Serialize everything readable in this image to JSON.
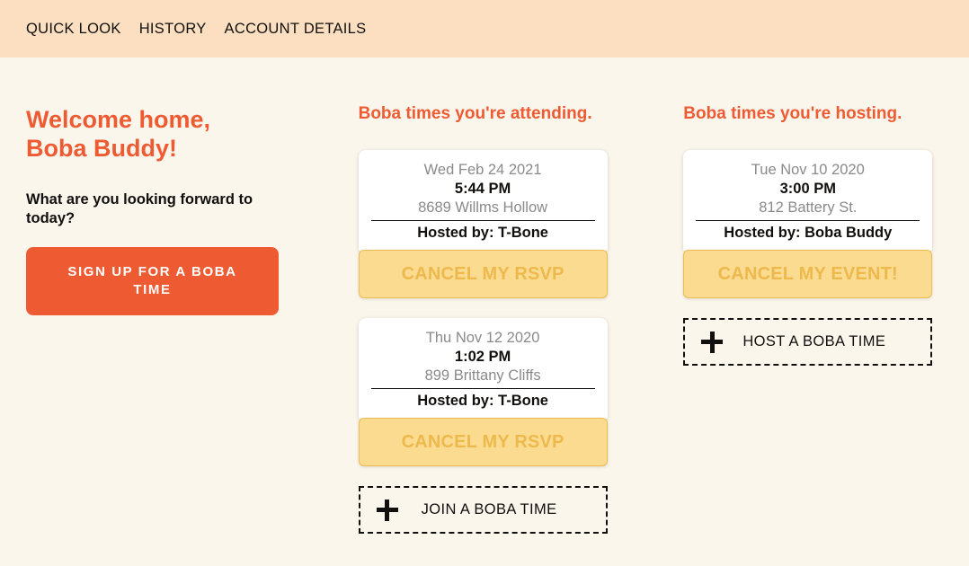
{
  "nav": {
    "links": [
      {
        "label": "Quick Look"
      },
      {
        "label": "History"
      },
      {
        "label": "Account Details"
      }
    ]
  },
  "welcome": {
    "title": "Welcome home, Boba Buddy!",
    "subtitle": "What are you looking forward to today?",
    "signup_label": "Sign Up For A Boba Time"
  },
  "attending": {
    "heading": "Boba times you're attending.",
    "events": [
      {
        "date": "Wed Feb 24 2021",
        "time": "5:44 PM",
        "location": "8689 Willms Hollow",
        "host": "Hosted by: T-Bone",
        "action_label": "Cancel My RSVP"
      },
      {
        "date": "Thu Nov 12 2020",
        "time": "1:02 PM",
        "location": "899 Brittany Cliffs",
        "host": "Hosted by: T-Bone",
        "action_label": "Cancel My RSVP"
      }
    ],
    "add_label": "Join A Boba Time",
    "add_icon": "plus-icon"
  },
  "hosting": {
    "heading": "Boba times you're hosting.",
    "events": [
      {
        "date": "Tue Nov 10 2020",
        "time": "3:00 PM",
        "location": "812 Battery St.",
        "host": "Hosted by: Boba Buddy",
        "action_label": "Cancel My Event!"
      }
    ],
    "add_label": "Host A Boba Time",
    "add_icon": "plus-icon"
  },
  "colors": {
    "nav_background": "#FBDFC0",
    "page_background": "#FAF6EC",
    "accent_orange": "#EE5B33",
    "amber_fill": "#FBDB8F",
    "amber_text": "#EDB94D",
    "muted_text": "#8A8A8A"
  }
}
